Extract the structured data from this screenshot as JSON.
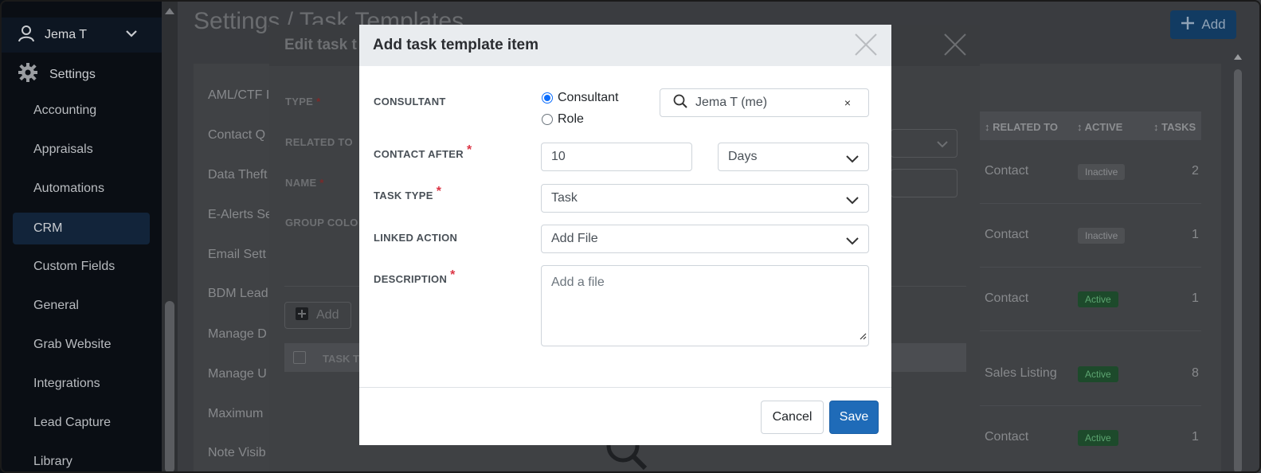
{
  "sidebar": {
    "user_name": "Jema T",
    "settings_label": "Settings",
    "items": [
      {
        "label": "Accounting"
      },
      {
        "label": "Appraisals"
      },
      {
        "label": "Automations"
      },
      {
        "label": "CRM",
        "active": true
      },
      {
        "label": "Custom Fields"
      },
      {
        "label": "General"
      },
      {
        "label": "Grab Website"
      },
      {
        "label": "Integrations"
      },
      {
        "label": "Lead Capture"
      },
      {
        "label": "Library"
      }
    ]
  },
  "background": {
    "page_title": "Settings / Task Templates",
    "add_label": "Add",
    "list_items": [
      "AML/CTF I",
      "Contact Q",
      "Data Theft",
      "E-Alerts Se",
      "Email Sett",
      "BDM Lead",
      "Manage D",
      "Manage U",
      "Maximum",
      "Note Visib"
    ],
    "table_headers": [
      "RELATED TO",
      "ACTIVE",
      "TASKS"
    ],
    "rows": [
      {
        "related_to": "Contact",
        "status": "Inactive",
        "tasks": "2"
      },
      {
        "related_to": "Contact",
        "status": "Inactive",
        "tasks": "1"
      },
      {
        "related_to": "Contact",
        "status": "Active",
        "tasks": "1"
      },
      {
        "related_to": "Sales Listing",
        "status": "Active",
        "tasks": "8"
      },
      {
        "related_to": "Contact",
        "status": "Active",
        "tasks": "1"
      }
    ]
  },
  "edit_modal": {
    "title": "Edit task t",
    "labels": {
      "type": "TYPE",
      "related_to": "RELATED TO",
      "name": "NAME",
      "group_color": "GROUP COLO"
    },
    "add_label": "Add",
    "table_header": "TASK T"
  },
  "add_modal": {
    "title": "Add task template item",
    "consultant_label": "CONSULTANT",
    "radio_consultant": "Consultant",
    "radio_role": "Role",
    "consultant_value": "Jema T (me)",
    "clear_symbol": "×",
    "contact_after_label": "CONTACT AFTER",
    "contact_after_value": "10",
    "contact_after_unit": "Days",
    "task_type_label": "TASK TYPE",
    "task_type_value": "Task",
    "linked_action_label": "LINKED ACTION",
    "linked_action_value": "Add File",
    "description_label": "DESCRIPTION",
    "description_placeholder": "Add a file",
    "required_mark": "*",
    "cancel_label": "Cancel",
    "save_label": "Save"
  },
  "colors": {
    "primary": "#1f6bb8",
    "required": "#dc3545",
    "sidebar_bg": "#0a0e14"
  }
}
